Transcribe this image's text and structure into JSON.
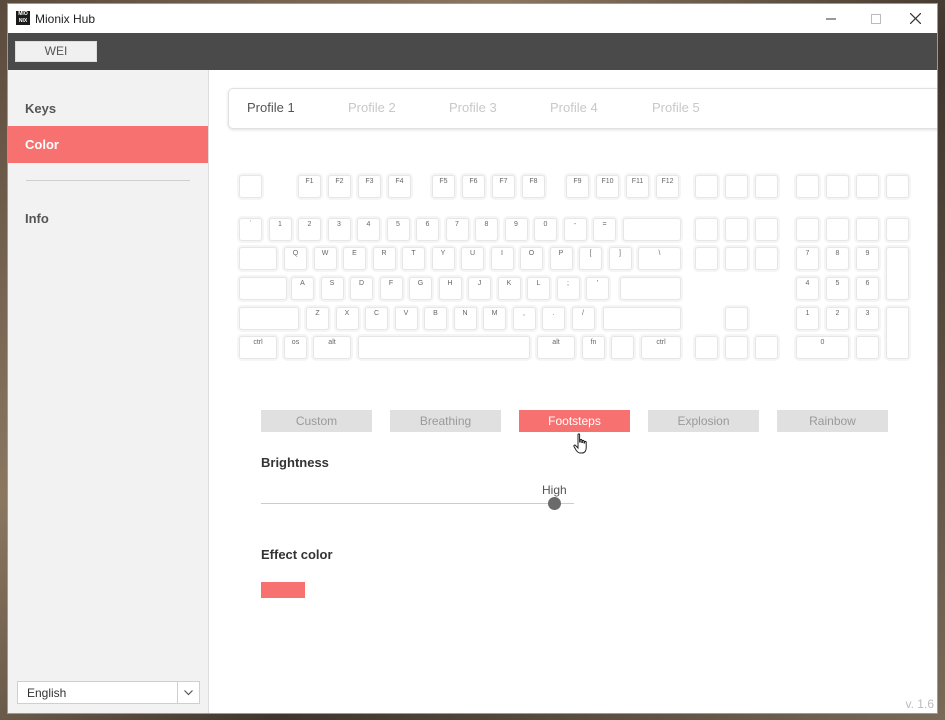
{
  "window": {
    "title": "Mionix Hub",
    "logo_text": "MIO\nNIX"
  },
  "topbar": {
    "user_label": "WEI"
  },
  "sidebar": {
    "items": [
      {
        "label": "Keys",
        "active": false
      },
      {
        "label": "Color",
        "active": true
      },
      {
        "label": "Info",
        "active": false
      }
    ],
    "language": "English"
  },
  "profiles": [
    "Profile 1",
    "Profile 2",
    "Profile 3",
    "Profile 4",
    "Profile 5"
  ],
  "active_profile": "Profile 1",
  "keyboard": {
    "function_row": [
      "F1",
      "F2",
      "F3",
      "F4",
      "F5",
      "F6",
      "F7",
      "F8",
      "F9",
      "F10",
      "F11",
      "F12"
    ],
    "number_row": [
      "`",
      "1",
      "2",
      "3",
      "4",
      "5",
      "6",
      "7",
      "8",
      "9",
      "0",
      "-",
      "="
    ],
    "qwerty_row": [
      "Q",
      "W",
      "E",
      "R",
      "T",
      "Y",
      "U",
      "I",
      "O",
      "P",
      "[",
      "]",
      "\\"
    ],
    "home_row": [
      "A",
      "S",
      "D",
      "F",
      "G",
      "H",
      "J",
      "K",
      "L",
      ";",
      "'"
    ],
    "shift_row": [
      "Z",
      "X",
      "C",
      "V",
      "B",
      "N",
      "M",
      ",",
      ".",
      "/"
    ],
    "bottom_row": [
      "ctrl",
      "os",
      "alt",
      "alt",
      "fn",
      "ctrl"
    ],
    "numpad": [
      "7",
      "8",
      "9",
      "4",
      "5",
      "6",
      "1",
      "2",
      "3",
      "0"
    ]
  },
  "effects": [
    "Custom",
    "Breathing",
    "Footsteps",
    "Explosion",
    "Rainbow"
  ],
  "active_effect": "Footsteps",
  "brightness": {
    "title": "Brightness",
    "level_label": "High",
    "value": 1.0
  },
  "effect_color": {
    "title": "Effect color",
    "color": "#f87171"
  },
  "version": "v. 1.6",
  "colors": {
    "accent": "#f87171",
    "topbar": "#4a4a4a"
  }
}
